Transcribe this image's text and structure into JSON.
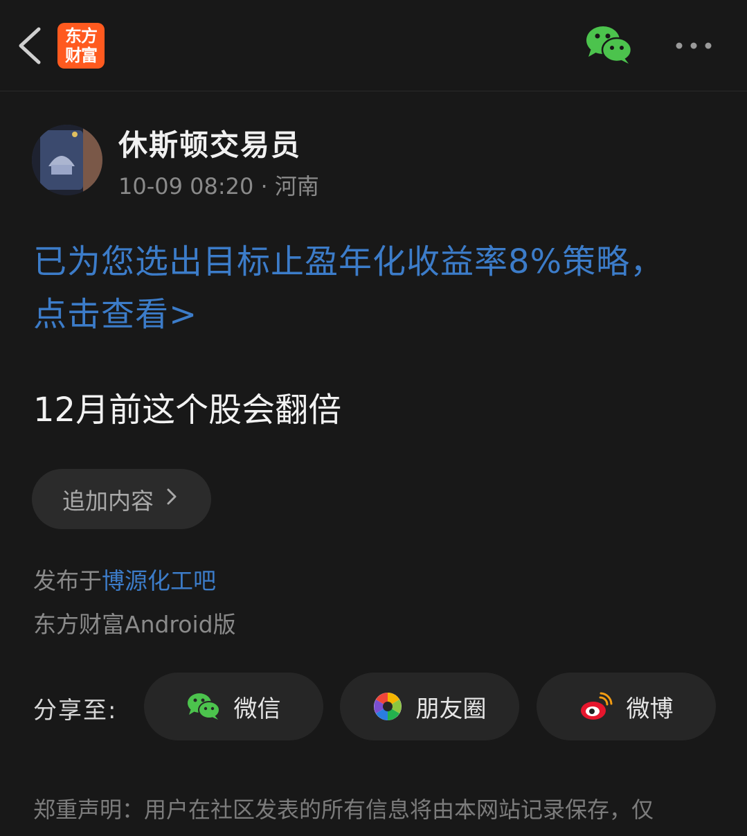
{
  "header": {
    "logo_line1": "东方",
    "logo_line2": "财富",
    "colors": {
      "logo": "#ff5a1f",
      "wechat": "#4cc34d"
    },
    "icons": [
      "back-arrow-icon",
      "wechat-icon",
      "more-dots-icon"
    ]
  },
  "post": {
    "author": "休斯顿交易员",
    "meta": "10-09 08:20 · 河南",
    "ad_link_line1": "已为您选出目标止盈年化收益率8%策略，",
    "ad_link_line2": "点击查看>",
    "title": "12月前这个股会翻倍",
    "add_content_label": "追加内容",
    "published_prefix": "发布于",
    "published_bar": "博源化工吧",
    "client": "东方财富Android版"
  },
  "share": {
    "label": "分享至:",
    "wechat": "微信",
    "moments": "朋友圈",
    "weibo": "微博"
  },
  "disclaimer": "郑重声明：用户在社区发表的所有信息将由本网站记录保存，仅",
  "link_color": "#3c7cc9"
}
